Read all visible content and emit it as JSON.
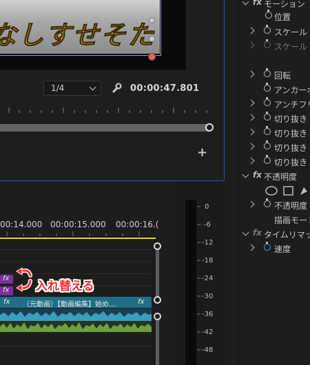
{
  "monitor": {
    "video_caption": "なしすせそた",
    "resolution": "1/4",
    "timecode": "00:00:47.801",
    "add_button": "+"
  },
  "timeline": {
    "ruler_labels": [
      "00:14.000",
      "00:00:15.000",
      "00:00:16.("
    ],
    "clip_title": "（元動画）【動画編集】始め…",
    "fx_badge": "fx",
    "annotation": "入れ替える"
  },
  "meter": {
    "db_labels": [
      "0",
      "-6",
      "-12",
      "-18",
      "-24",
      "-30",
      "-36",
      "-42",
      "-48"
    ]
  },
  "effect_controls": {
    "motion": "モーション",
    "position": "位置",
    "scale": "スケール",
    "scale_width": "スケール (",
    "rotation": "回転",
    "anchor": "アンカーポ",
    "antiflicker": "アンチフリ",
    "crop1": "切り抜き (",
    "crop2": "切り抜き (",
    "crop3": "切り抜き (",
    "crop4": "切り抜き (",
    "opacity_header": "不透明度",
    "opacity": "不透明度",
    "blend_mode": "描画モード",
    "time_remap": "タイムリマッ",
    "speed": "速度",
    "fx_icon": "fx"
  }
}
